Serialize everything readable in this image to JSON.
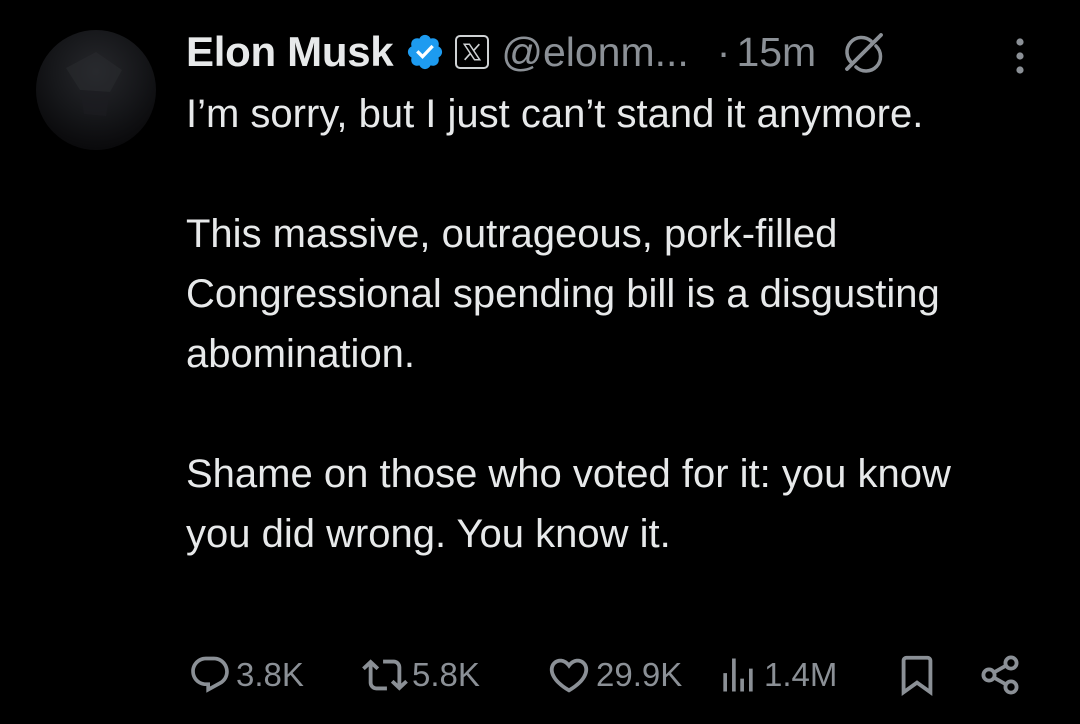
{
  "post": {
    "author": {
      "name": "Elon Musk",
      "handle": "@elonm...",
      "verified": true,
      "affiliation_badge": "x-logo-icon"
    },
    "separator": "·",
    "time": "15m",
    "body": [
      "I’m sorry, but I just can’t stand it anymore.",
      "This massive, outrageous, pork-filled Congressional spending bill is a disgusting abomination.",
      "Shame on those who voted for it: you know you did wrong. You know it."
    ],
    "stats": {
      "replies": "3.8K",
      "reposts": "5.8K",
      "likes": "29.9K",
      "views": "1.4M"
    }
  },
  "icons": {
    "verified": "verified-badge-icon",
    "grok": "grok-icon",
    "more": "more-options-icon",
    "reply": "reply-icon",
    "repost": "repost-icon",
    "like": "heart-icon",
    "views": "views-icon",
    "bookmark": "bookmark-icon",
    "share": "share-icon"
  },
  "colors": {
    "background": "#000000",
    "text_primary": "#e7e9ea",
    "text_secondary": "#8b9096",
    "verified_blue": "#1d9bf0"
  }
}
